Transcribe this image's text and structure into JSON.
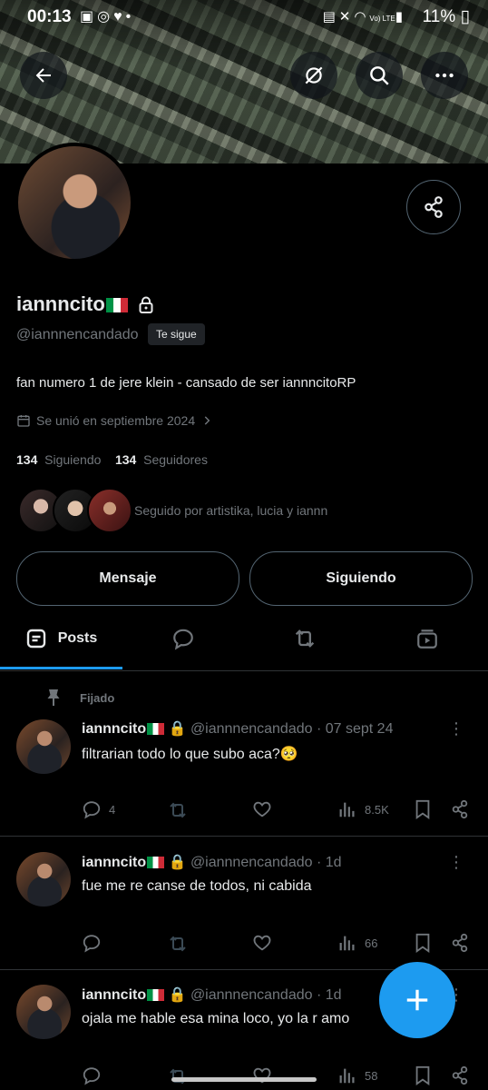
{
  "status_bar": {
    "time": "00:13",
    "battery": "11%",
    "left_icons": [
      "gallery-icon",
      "whatsapp-icon",
      "heart-icon",
      "dot-icon"
    ],
    "right_icons": [
      "screenshot-icon",
      "mute-icon",
      "wifi-icon",
      "volte-icon",
      "signal-icon"
    ],
    "volte": "Vo) LTE"
  },
  "profile": {
    "name": "iannncito",
    "handle": "@iannnencandado",
    "follows_you": "Te sigue",
    "bio": "fan numero 1 de jere klein - cansado de ser iannncitoRP",
    "joined": "Se unió en septiembre 2024",
    "following_count": "134",
    "following_label": "Siguiendo",
    "followers_count": "134",
    "followers_label": "Seguidores",
    "followed_by": "Seguido por artistika, lucia y iannn"
  },
  "buttons": {
    "message": "Mensaje",
    "following": "Siguiendo"
  },
  "tabs": {
    "posts": "Posts"
  },
  "pinned_label": "Fijado",
  "tweets": [
    {
      "name": "iannncito",
      "handle": "@iannnencandado",
      "time": "07 sept 24",
      "text": "filtrarian todo lo que subo aca?🥺",
      "replies": "4",
      "views": "8.5K"
    },
    {
      "name": "iannncito",
      "handle": "@iannnencandado",
      "time": "1d",
      "text": "fue me re canse de todos, ni cabida",
      "replies": "",
      "views": "66"
    },
    {
      "name": "iannncito",
      "handle": "@iannnencandado",
      "time": "1d",
      "text": "ojala me hable esa mina loco, yo la r amo",
      "replies": "",
      "views": "58"
    }
  ],
  "colors": {
    "accent": "#1d9bf0",
    "background": "#000000",
    "text_primary": "#e7e9ea",
    "text_secondary": "#71767b",
    "border": "#2f3336"
  }
}
